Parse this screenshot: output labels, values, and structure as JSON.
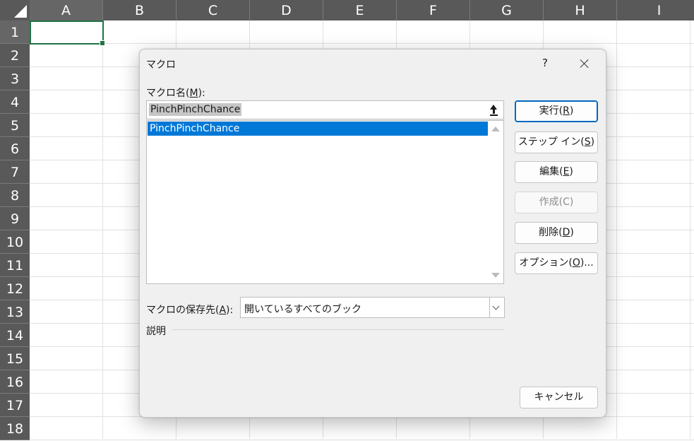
{
  "spreadsheet": {
    "columns": [
      "A",
      "B",
      "C",
      "D",
      "E",
      "F",
      "G",
      "H",
      "I"
    ],
    "rows": [
      "1",
      "2",
      "3",
      "4",
      "5",
      "6",
      "7",
      "8",
      "9",
      "10",
      "11",
      "12",
      "13",
      "14",
      "15",
      "16",
      "17",
      "18"
    ],
    "selected_cell": "A1",
    "accent_color": "#217346"
  },
  "dialog": {
    "title": "マクロ",
    "help_label": "?",
    "macro_name_label_prefix": "マクロ名(",
    "macro_name_label_key": "M",
    "macro_name_label_suffix": "):",
    "macro_name_value": "PinchPinchChance",
    "macro_list": [
      "PinchPinchChance"
    ],
    "buttons": {
      "run": {
        "prefix": "実行(",
        "key": "R",
        "suffix": ")"
      },
      "step_into": {
        "prefix": "ステップ イン(",
        "key": "S",
        "suffix": ")"
      },
      "edit": {
        "prefix": "編集(",
        "key": "E",
        "suffix": ")"
      },
      "create": {
        "label": "作成(C)"
      },
      "delete": {
        "prefix": "削除(",
        "key": "D",
        "suffix": ")"
      },
      "options": {
        "prefix": "オプション(",
        "key": "O",
        "suffix": ")..."
      },
      "cancel": {
        "label": "キャンセル"
      }
    },
    "macros_in_label_prefix": "マクロの保存先(",
    "macros_in_label_key": "A",
    "macros_in_label_suffix": "):",
    "macros_in_value": "開いているすべてのブック",
    "description_label": "説明",
    "selection_color": "#0078d7"
  }
}
